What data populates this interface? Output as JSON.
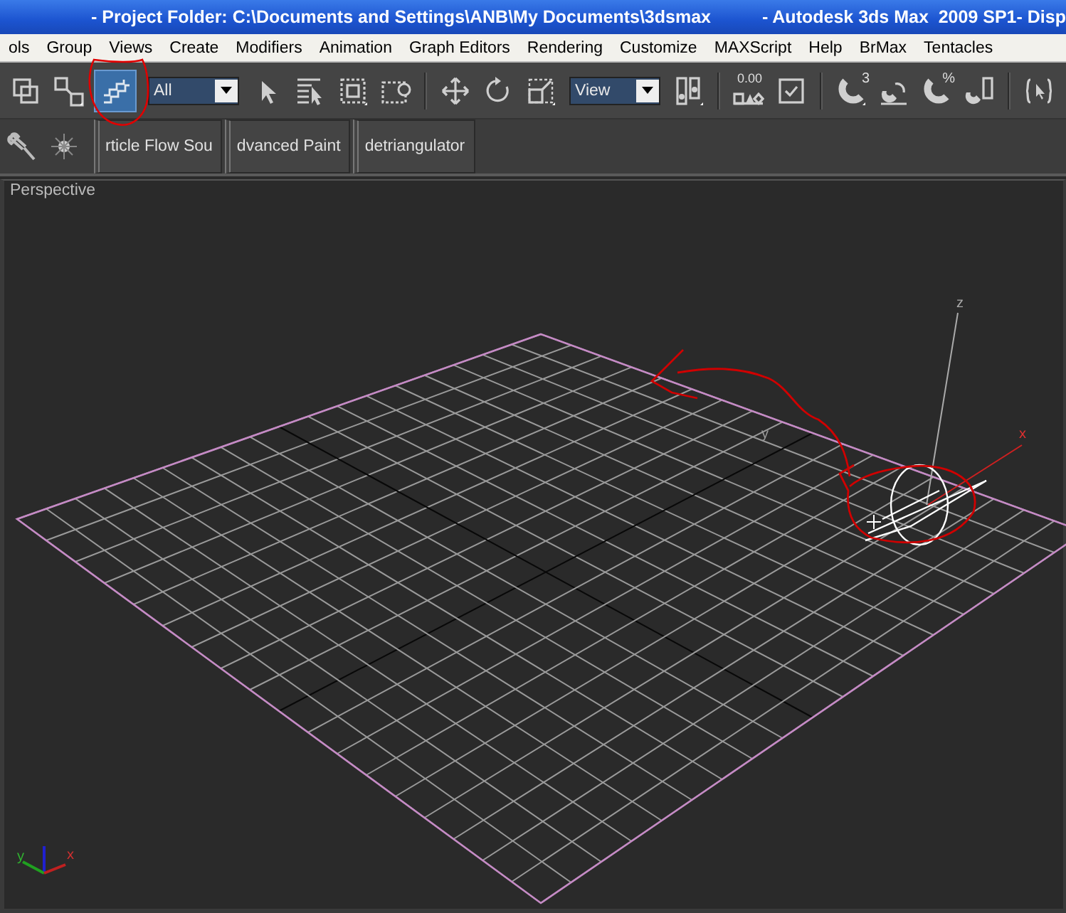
{
  "window": {
    "title_parts": [
      "- Project Folder: C:\\Documents and Settings\\ANB\\My Documents\\3dsmax",
      "- Autodesk 3ds Max  2009 SP1",
      "- Disp"
    ]
  },
  "menu": [
    "ols",
    "Group",
    "Views",
    "Create",
    "Modifiers",
    "Animation",
    "Graph Editors",
    "Rendering",
    "Customize",
    "MAXScript",
    "Help",
    "BrMax",
    "Tentacles"
  ],
  "toolbar": [
    {
      "kind": "button",
      "on": false
    },
    {
      "kind": "button",
      "on": false
    },
    {
      "kind": "button",
      "on": true
    },
    {
      "kind": "dropdown",
      "value": "All"
    },
    {
      "kind": "button",
      "on": false
    },
    {
      "kind": "button",
      "on": false
    },
    {
      "kind": "button",
      "on": false
    },
    {
      "kind": "button",
      "on": false
    },
    {
      "kind": "separator"
    },
    {
      "kind": "button",
      "on": false
    },
    {
      "kind": "button",
      "on": false
    },
    {
      "kind": "button",
      "on": false
    },
    {
      "kind": "dropdown",
      "value": "View"
    },
    {
      "kind": "button",
      "on": false
    },
    {
      "kind": "separator"
    },
    {
      "kind": "button",
      "on": false,
      "label": "0.00"
    },
    {
      "kind": "button",
      "on": false
    },
    {
      "kind": "separator"
    },
    {
      "kind": "button",
      "on": false,
      "label": "3"
    },
    {
      "kind": "button",
      "on": false
    },
    {
      "kind": "button",
      "on": false,
      "label": "%"
    },
    {
      "kind": "button",
      "on": false
    },
    {
      "kind": "separator"
    },
    {
      "kind": "button",
      "on": false
    }
  ],
  "tab_toolbar": {
    "tabs": [
      "rticle Flow Sou",
      "dvanced Paint",
      "detriangulator"
    ]
  },
  "viewport": {
    "label": "Perspective",
    "gizmo_axes": [
      "z",
      "y",
      "x"
    ],
    "tripod_axes": [
      "y",
      "x"
    ]
  }
}
